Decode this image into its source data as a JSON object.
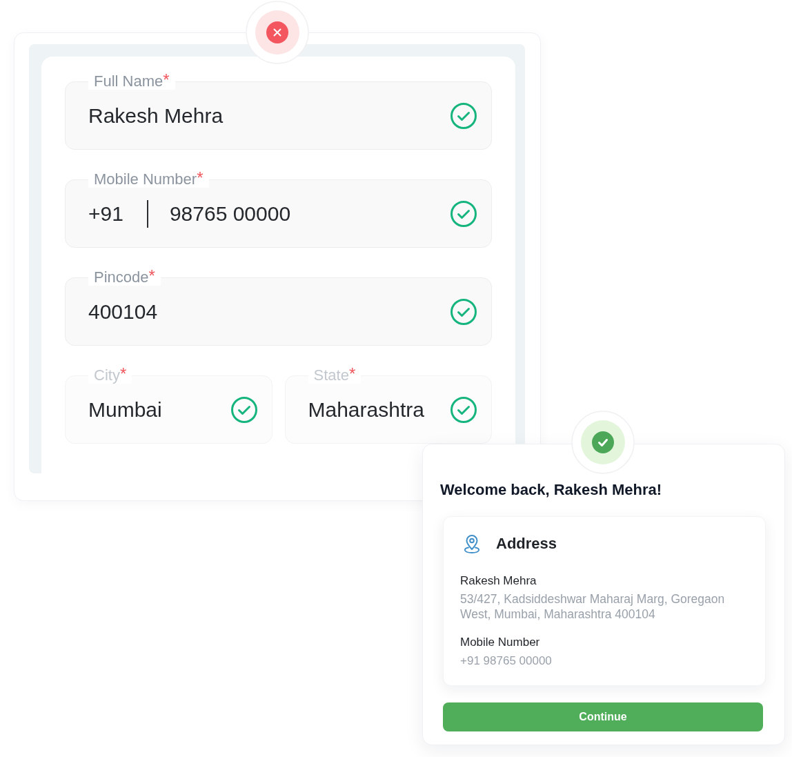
{
  "form_card": {
    "rows": [
      {
        "fields": [
          {
            "label": "Full Name",
            "required_mark": "*",
            "value": "Rakesh Mehra",
            "valid": true,
            "disabled": false
          }
        ]
      },
      {
        "fields": [
          {
            "label": "Mobile Number",
            "required_mark": "*",
            "prefix": "+91",
            "value": "98765 00000",
            "valid": true,
            "disabled": false
          }
        ]
      },
      {
        "fields": [
          {
            "label": "Pincode",
            "required_mark": "*",
            "value": "400104",
            "valid": true,
            "disabled": false
          }
        ]
      },
      {
        "fields": [
          {
            "label": "City",
            "required_mark": "*",
            "value": "Mumbai",
            "valid": true,
            "disabled": true
          },
          {
            "label": "State",
            "required_mark": "*",
            "value": "Maharashtra",
            "valid": true,
            "disabled": true
          }
        ]
      }
    ]
  },
  "welcome_card": {
    "title": "Welcome back, Rakesh Mehra!",
    "address": {
      "heading": "Address",
      "name": "Rakesh Mehra",
      "address": "53/427, Kadsiddeshwar Maharaj Marg, Goregaon West, Mumbai, Maharashtra 400104",
      "mobile_label": "Mobile Number",
      "mobile": "+91 98765 00000"
    },
    "button": "Continue"
  }
}
